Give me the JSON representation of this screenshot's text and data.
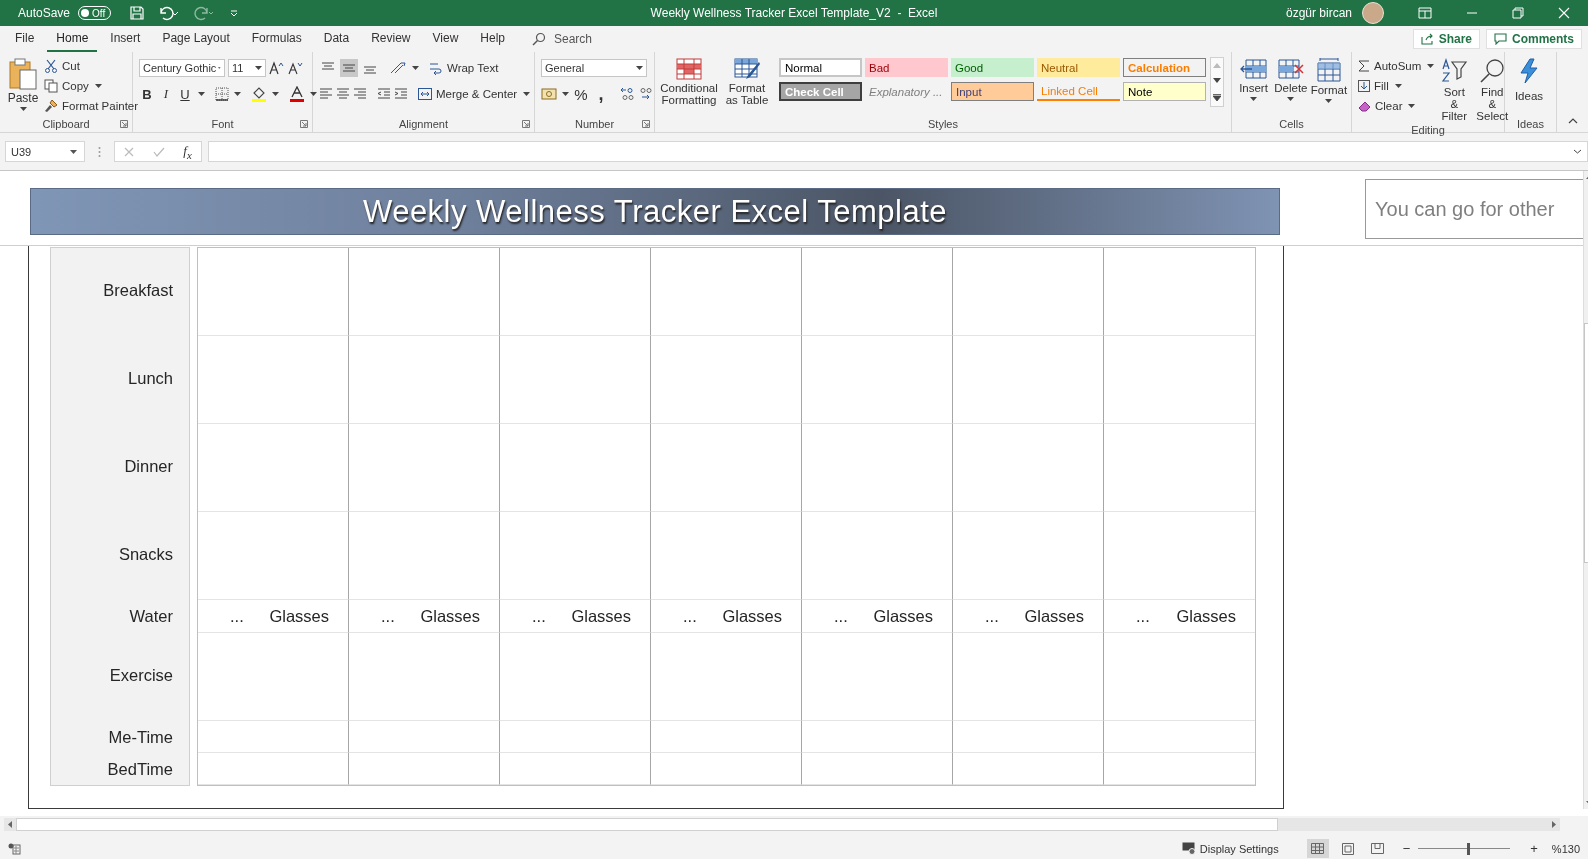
{
  "title_bar": {
    "autosave": {
      "label": "AutoSave",
      "toggle": "Off",
      "on": false
    },
    "title": "Weekly Wellness Tracker Excel Template_V2  -  Excel",
    "user": "özgür bircan"
  },
  "tabs": [
    {
      "label": "File",
      "selected": false
    },
    {
      "label": "Home",
      "selected": true
    },
    {
      "label": "Insert",
      "selected": false
    },
    {
      "label": "Page Layout",
      "selected": false
    },
    {
      "label": "Formulas",
      "selected": false
    },
    {
      "label": "Data",
      "selected": false
    },
    {
      "label": "Review",
      "selected": false
    },
    {
      "label": "View",
      "selected": false
    },
    {
      "label": "Help",
      "selected": false
    }
  ],
  "search": {
    "placeholder": "Search"
  },
  "share": "Share",
  "comments": "Comments",
  "clipboard": {
    "paste": "Paste",
    "cut": "Cut",
    "copy": "Copy",
    "format_painter": "Format Painter",
    "label": "Clipboard"
  },
  "font": {
    "name": "Century Gothic",
    "size": "11",
    "bold": "B",
    "italic": "I",
    "underline": "U",
    "label": "Font"
  },
  "alignment": {
    "vertical": [
      {
        "selected": false
      },
      {
        "selected": true
      },
      {
        "selected": false
      }
    ],
    "wrap_text": "Wrap Text",
    "merge": "Merge & Center",
    "label": "Alignment"
  },
  "number": {
    "format": "General",
    "percent": "%",
    "comma": ",",
    "label": "Number"
  },
  "styles": {
    "conditional": "Conditional Formatting",
    "format_table": "Format as Table",
    "label": "Styles",
    "cell_styles": [
      {
        "label": "Normal",
        "kind": "normal"
      },
      {
        "label": "Bad",
        "kind": "bad"
      },
      {
        "label": "Good",
        "kind": "good"
      },
      {
        "label": "Neutral",
        "kind": "neutral"
      },
      {
        "label": "Calculation",
        "kind": "calculation"
      },
      {
        "label": "Check Cell",
        "kind": "check"
      },
      {
        "label": "Explanatory ...",
        "kind": "explanatory"
      },
      {
        "label": "Input",
        "kind": "input"
      },
      {
        "label": "Linked Cell",
        "kind": "linked"
      },
      {
        "label": "Note",
        "kind": "note"
      }
    ]
  },
  "cells": {
    "label": "Cells",
    "buttons": [
      {
        "label": "Insert",
        "kind": "insert"
      },
      {
        "label": "Delete",
        "kind": "delete"
      },
      {
        "label": "Format",
        "kind": "format"
      }
    ]
  },
  "editing": {
    "autosum": "AutoSum",
    "fill": "Fill",
    "clear": "Clear",
    "sort": "Sort & Filter",
    "find": "Find & Select",
    "label": "Editing"
  },
  "ideas": {
    "button": "Ideas",
    "label": "Ideas"
  },
  "formula_bar": {
    "name_box": "U39",
    "fx": "f$_{x}$"
  },
  "sheet": {
    "banner": "Weekly Wellness Tracker Excel Template",
    "note": "You can go for other",
    "rows": [
      {
        "label": "Breakfast",
        "kind": "tall"
      },
      {
        "label": "Lunch",
        "kind": "tall"
      },
      {
        "label": "Dinner",
        "kind": "tall"
      },
      {
        "label": "Snacks",
        "kind": "tall"
      },
      {
        "label": "Water",
        "kind": "water",
        "cells": [
          {
            "amount": "...",
            "unit": "Glasses"
          },
          {
            "amount": "...",
            "unit": "Glasses"
          },
          {
            "amount": "...",
            "unit": "Glasses"
          },
          {
            "amount": "...",
            "unit": "Glasses"
          },
          {
            "amount": "...",
            "unit": "Glasses"
          },
          {
            "amount": "...",
            "unit": "Glasses"
          },
          {
            "amount": "...",
            "unit": "Glasses"
          }
        ]
      },
      {
        "label": "Exercise",
        "kind": "tall"
      },
      {
        "label": "Me-Time",
        "kind": "short"
      },
      {
        "label": "BedTime",
        "kind": "short"
      }
    ]
  },
  "status_bar": {
    "display_settings": "Display Settings",
    "views": [
      {
        "kind": "normal",
        "selected": true
      },
      {
        "kind": "page_layout",
        "selected": false
      },
      {
        "kind": "page_break",
        "selected": false
      }
    ],
    "zoom": {
      "minus": "−",
      "plus": "+",
      "level": 0.55,
      "reading": "%130"
    }
  }
}
